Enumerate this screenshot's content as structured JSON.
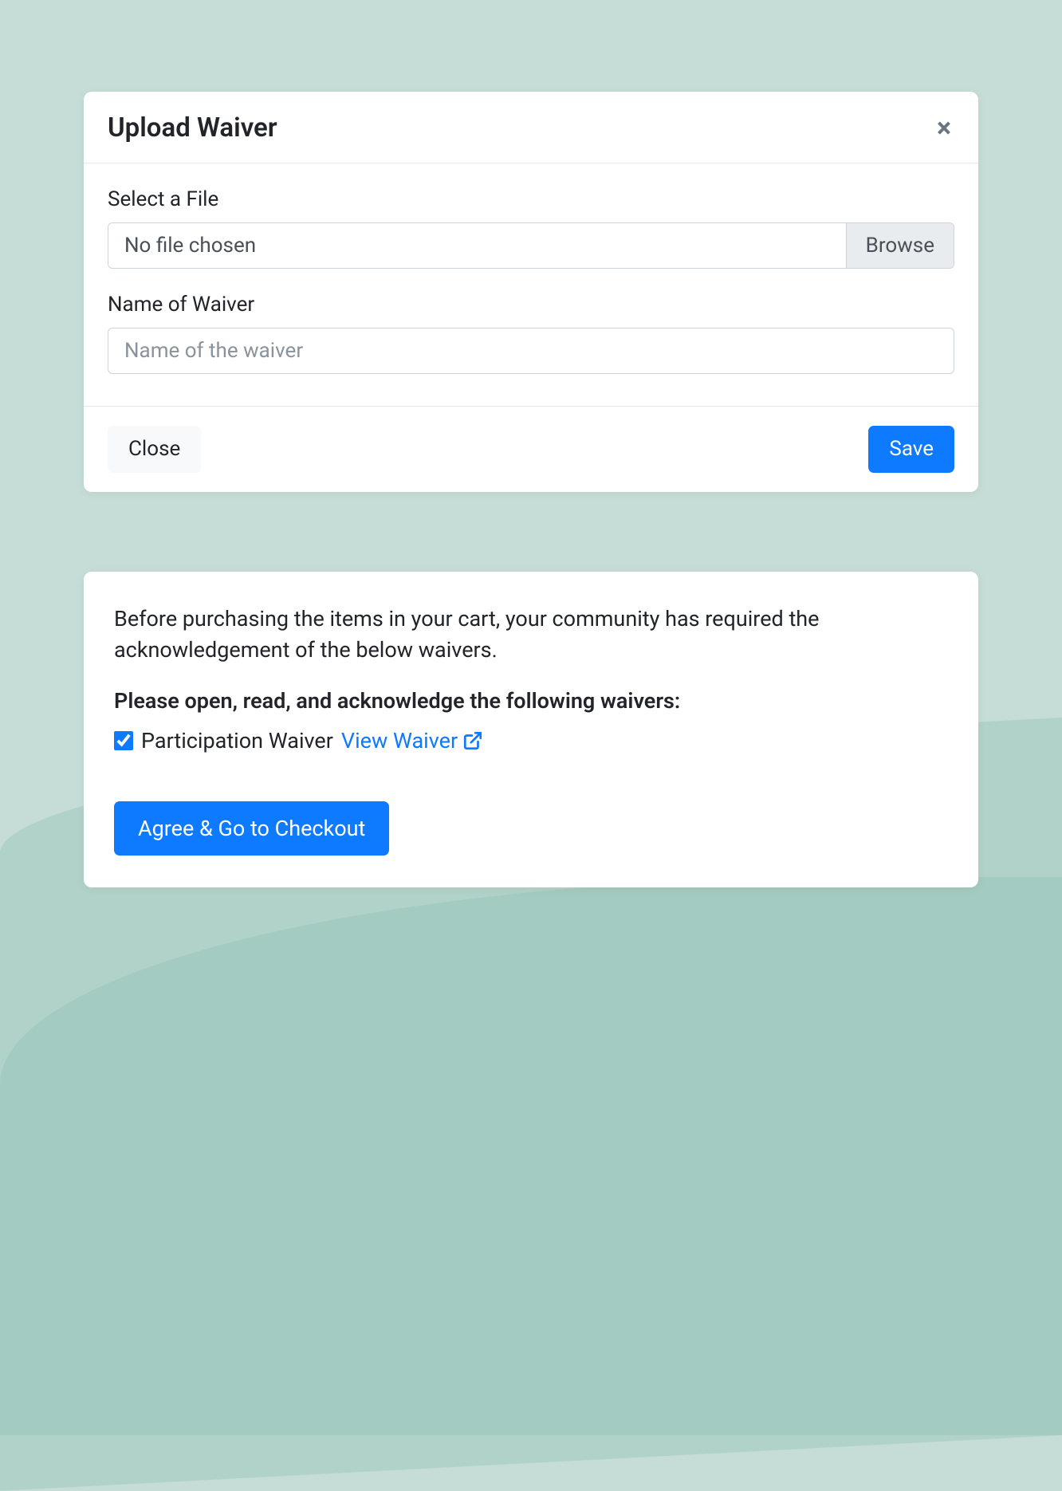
{
  "modal": {
    "title": "Upload Waiver",
    "close_icon_label": "×",
    "file": {
      "label": "Select a File",
      "placeholder_text": "No file chosen",
      "browse_label": "Browse"
    },
    "name": {
      "label": "Name of Waiver",
      "placeholder": "Name of the waiver"
    },
    "footer": {
      "close_label": "Close",
      "save_label": "Save"
    }
  },
  "waiver_panel": {
    "intro": "Before purchasing the items in your cart, your community has required the acknowledgement of the below waivers.",
    "prompt": "Please open, read, and acknowledge the following waivers:",
    "item": {
      "name": "Participation Waiver",
      "checked": true,
      "view_label": "View Waiver"
    },
    "checkout_label": "Agree & Go to Checkout"
  },
  "colors": {
    "primary": "#0d7aff",
    "bg": "#c5ddd6"
  }
}
